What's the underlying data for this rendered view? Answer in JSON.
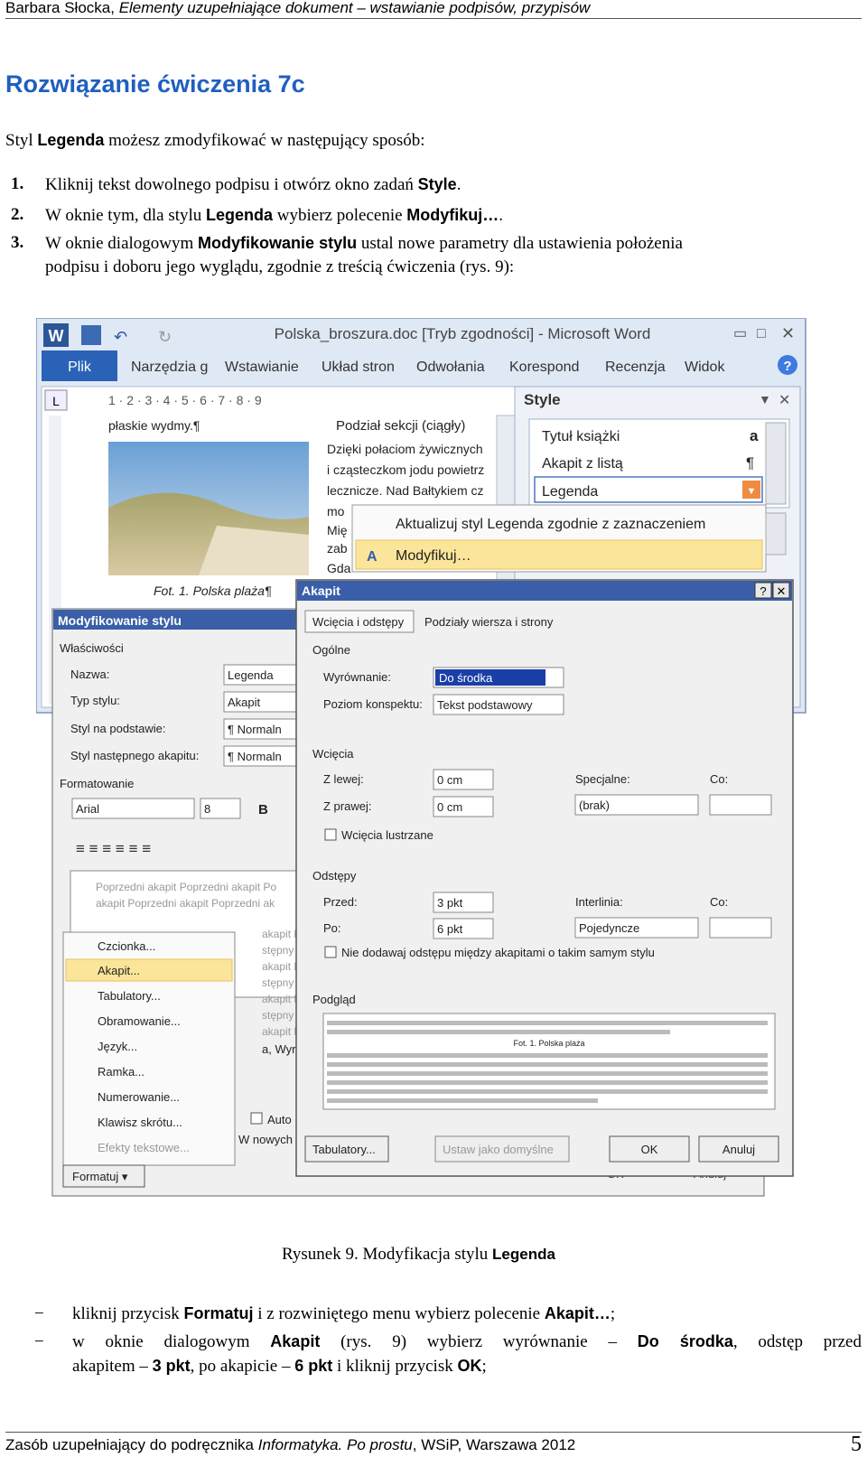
{
  "header": {
    "author": "Barbara Słocka, ",
    "title": "Elementy uzupełniające dokument – wstawianie podpisów, przypisów"
  },
  "heading": "Rozwiązanie ćwiczenia 7c",
  "intro": {
    "pre": "Styl ",
    "bold": "Legenda",
    "post": " możesz zmodyfikować w następujący sposób:"
  },
  "steps": [
    {
      "num": "1.",
      "t1": "Kliknij tekst dowolnego podpisu i otwórz okno zadań ",
      "b1": "Style",
      "t2": "."
    },
    {
      "num": "2.",
      "t1": "W oknie tym, dla stylu ",
      "b1": "Legenda",
      "t2": " wybierz polecenie ",
      "b2": "Modyfikuj…",
      "t3": "."
    },
    {
      "num": "3.",
      "t1": "W oknie dialogowym ",
      "b1": "Modyfikowanie stylu",
      "t2": " ustal nowe parametry dla ustawienia położenia",
      "line2": "podpisu i doboru jego wyglądu, zgodnie z treścią ćwiczenia (rys. 9):"
    }
  ],
  "screenshot": {
    "word_title": "Polska_broszura.doc [Tryb zgodności] - Microsoft Word",
    "ribbon_tabs": [
      "Plik",
      "Narzędzia g",
      "Wstawianie",
      "Układ stron",
      "Odwołania",
      "Korespond",
      "Recenzja",
      "Widok"
    ],
    "ruler": "1 · 2 · 3 · 4 · 5 · 6 · 7 · 8 · 9",
    "doc_lines": [
      "płaskie wydmy.¶",
      "Podział sekcji (ciągły)",
      "Dzięki połaciom żywicznych",
      "i cząsteczkom jodu powietrz",
      "lecznicze. Nad Bałtykiem cz",
      "mo",
      "Mię",
      "zab",
      "Gda"
    ],
    "photo_caption": "Fot. 1. Polska plaża¶",
    "style_pane": {
      "title": "Style",
      "items": [
        "Tytuł książki",
        "Akapit z listą",
        "Legenda"
      ],
      "marks": [
        "a",
        "¶"
      ]
    },
    "context_menu": [
      "Aktualizuj styl Legenda zgodnie z zaznaczeniem",
      "Modyfikuj…"
    ],
    "modify_dialog": {
      "title": "Modyfikowanie stylu",
      "section_props": "Właściwości",
      "labels": [
        "Nazwa:",
        "Typ stylu:",
        "Styl na podstawie:",
        "Styl następnego akapitu:"
      ],
      "values": [
        "Legenda",
        "Akapit",
        "¶ Normaln",
        "¶ Normaln"
      ],
      "section_format": "Formatowanie",
      "font": "Arial",
      "size": "8",
      "bold_btn": "B",
      "preview": [
        "Poprzedni akapit Poprzedni akapit Po",
        "akapit Poprzedni akapit Poprzedni ak",
        "akapit Nas",
        "stępny aka",
        "akapit Nas",
        "stępny aka",
        "akapit Nas",
        "stępny aka",
        "akapit Nas",
        "a, Wyrówna"
      ],
      "menu": [
        "Czcionka...",
        "Akapit...",
        "Tabulatory...",
        "Obramowanie...",
        "Język...",
        "Ramka...",
        "Numerowanie...",
        "Klawisz skrótu...",
        "Efekty tekstowe..."
      ],
      "auto": "Auto",
      "new_docs": "W nowych",
      "format_btn": "Formatuj ▾",
      "ok": "OK",
      "cancel": "Anuluj"
    },
    "para_dialog": {
      "title": "Akapit",
      "tabs": [
        "Wcięcia i odstępy",
        "Podziały wiersza i strony"
      ],
      "general": "Ogólne",
      "align_label": "Wyrównanie:",
      "align_value": "Do środka",
      "outline_label": "Poziom konspektu:",
      "outline_value": "Tekst podstawowy",
      "indent": "Wcięcia",
      "left_label": "Z lewej:",
      "left_value": "0 cm",
      "right_label": "Z prawej:",
      "right_value": "0 cm",
      "special_label": "Specjalne:",
      "special_value": "(brak)",
      "by_label": "Co:",
      "mirror": "Wcięcia lustrzane",
      "spacing": "Odstępy",
      "before_label": "Przed:",
      "before_value": "3 pkt",
      "after_label": "Po:",
      "after_value": "6 pkt",
      "line_label": "Interlinia:",
      "line_value": "Pojedyncze",
      "at_label": "Co:",
      "no_space": "Nie dodawaj odstępu między akapitami o takim samym stylu",
      "preview_label": "Podgląd",
      "preview_caption": "Fot. 1. Polska plaża",
      "tabs_btn": "Tabulatory...",
      "default_btn": "Ustaw jako domyślne",
      "ok": "OK",
      "cancel": "Anuluj"
    }
  },
  "caption": {
    "pre": "Rysunek 9. Modyfikacja stylu ",
    "bold": "Legenda"
  },
  "bullets": [
    {
      "dash": "−",
      "t1": "kliknij przycisk ",
      "b1": "Formatuj",
      "t2": " i z rozwiniętego menu wybierz polecenie ",
      "b2": "Akapit…",
      "t3": ";"
    },
    {
      "dash": "−",
      "t1": "w oknie dialogowym ",
      "b1": "Akapit",
      "t2": " (rys. 9) wybierz wyrównanie – ",
      "b2": "Do środka",
      "t3": ", odstęp przed",
      "l2a": "akapitem – ",
      "l2b": "3 pkt",
      "l2c": ", po akapicie – ",
      "l2d": "6 pkt",
      "l2e": " i kliknij przycisk ",
      "l2f": "OK",
      "l2g": ";"
    }
  ],
  "footer": {
    "pre": "Zasób uzupełniający do podręcznika ",
    "italic": "Informatyka. Po prostu",
    "post": ", WSiP, Warszawa 2012",
    "page": "5"
  }
}
